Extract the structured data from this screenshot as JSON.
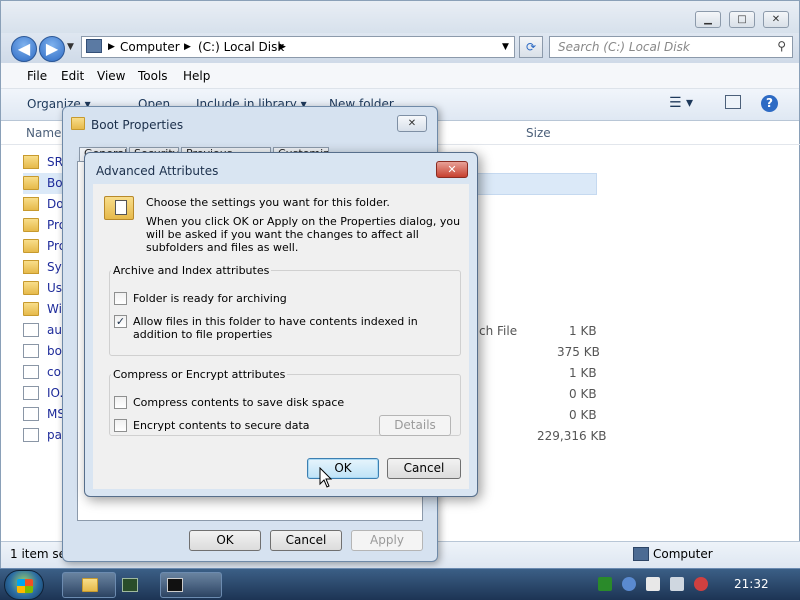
{
  "explorer": {
    "address": {
      "computer": "Computer",
      "disk": "(C:) Local Disk"
    },
    "search_placeholder": "Search (C:) Local Disk",
    "menu": [
      "File",
      "Edit",
      "View",
      "Tools",
      "Help"
    ],
    "commands": {
      "organize": "Organize ▾",
      "open": "Open",
      "include": "Include in library ▾",
      "new_folder": "New folder"
    },
    "columns": {
      "name": "Name",
      "size": "Size"
    },
    "files": [
      {
        "name": "SR",
        "type": "lock-folder"
      },
      {
        "name": "Bo",
        "type": "folder",
        "selected": true
      },
      {
        "name": "Do",
        "type": "lock-folder"
      },
      {
        "name": "Pro",
        "type": "folder"
      },
      {
        "name": "Pro",
        "type": "folder"
      },
      {
        "name": "Sys",
        "type": "lock-folder"
      },
      {
        "name": "Use",
        "type": "folder"
      },
      {
        "name": "Wi",
        "type": "folder"
      },
      {
        "name": "aut",
        "type": "file"
      },
      {
        "name": "bo",
        "type": "file"
      },
      {
        "name": "co",
        "type": "file"
      },
      {
        "name": "IO.",
        "type": "file"
      },
      {
        "name": "MS",
        "type": "file"
      },
      {
        "name": "pa",
        "type": "file"
      }
    ],
    "type_fragment": "ch File",
    "sizes": [
      "1 KB",
      "375 KB",
      "1 KB",
      "0 KB",
      "0 KB",
      "229,316 KB"
    ],
    "status_left": "1 item sel",
    "status_right": "Computer"
  },
  "props_dialog": {
    "title": "Boot Properties",
    "tabs": [
      "General",
      "Security",
      "Previous Versions",
      "Customize"
    ],
    "ok": "OK",
    "cancel": "Cancel",
    "apply": "Apply"
  },
  "advanced": {
    "title": "Advanced Attributes",
    "intro1": "Choose the settings you want for this folder.",
    "intro2": "When you click OK or Apply on the Properties dialog, you will be asked if you want the changes to affect all subfolders and files as well.",
    "archive_group": "Archive and Index attributes",
    "archiving": "Folder is ready for archiving",
    "archiving_checked": false,
    "indexing": "Allow files in this folder to have contents indexed in addition to file properties",
    "indexing_checked": true,
    "compress_group": "Compress or Encrypt attributes",
    "compress": "Compress contents to save disk space",
    "compress_checked": false,
    "encrypt": "Encrypt contents to secure data",
    "encrypt_checked": false,
    "details": "Details",
    "ok": "OK",
    "cancel": "Cancel"
  },
  "taskbar": {
    "clock": "21:32"
  }
}
